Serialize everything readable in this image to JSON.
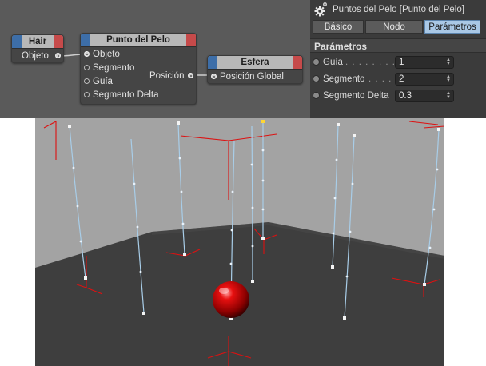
{
  "node_editor": {
    "nodes": {
      "hair": {
        "title": "Hair",
        "ports": [
          "Objeto"
        ]
      },
      "punto_del_pelo": {
        "title": "Punto del Pelo",
        "inputs": [
          "Objeto",
          "Segmento",
          "Guía",
          "Segmento Delta"
        ],
        "outputs": [
          "Posición"
        ]
      },
      "esfera": {
        "title": "Esfera",
        "inputs": [
          "Posición Global"
        ]
      }
    }
  },
  "attributes": {
    "title": "Puntos del Pelo [Punto del Pelo]",
    "tabs": [
      {
        "label": "Básico",
        "active": false
      },
      {
        "label": "Nodo",
        "active": false
      },
      {
        "label": "Parámetros",
        "active": true
      }
    ],
    "section": "Parámetros",
    "params": [
      {
        "label": "Guía",
        "dots": ". . . . . . . . . .",
        "value": "1"
      },
      {
        "label": "Segmento",
        "dots": ". . . . .",
        "value": "2"
      },
      {
        "label": "Segmento Delta",
        "dots": "",
        "value": "0.3"
      }
    ]
  },
  "colors": {
    "node_editor_bg": "#5a5a5a",
    "node_header": "#b8b8b8",
    "input_cap": "#3d6ea8",
    "output_cap": "#c64a4a",
    "active_tab": "#a9c8e6",
    "viewport_bg": "#a3a3a3",
    "floor": "#3e3e3e",
    "hair_guides": "#a8cde8",
    "sphere": "#d00000",
    "axes": "#dd1111"
  }
}
